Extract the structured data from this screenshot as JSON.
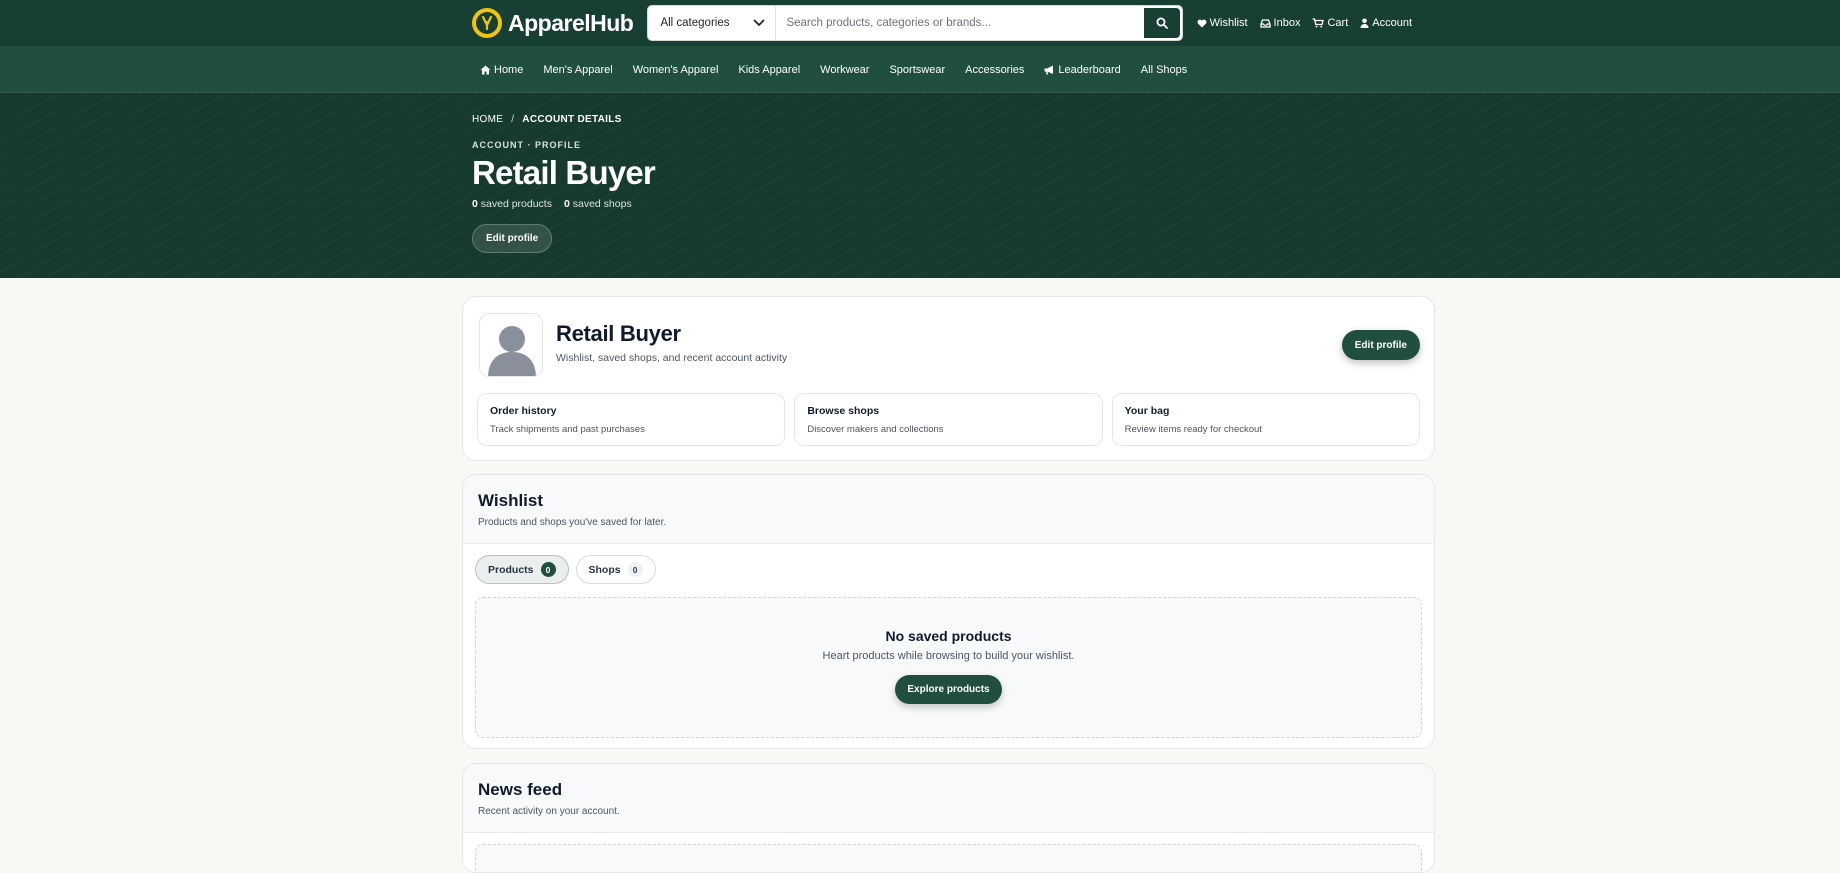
{
  "brand": {
    "name": "ApparelHub",
    "logo_icon": "lightning-bolt-icon",
    "logo_color": "#f2c40f"
  },
  "search": {
    "category": "All categories",
    "placeholder": "Search products, categories or brands..."
  },
  "top_links": [
    {
      "label": "Wishlist",
      "icon": "heart-icon"
    },
    {
      "label": "Inbox",
      "icon": "inbox-icon"
    },
    {
      "label": "Cart",
      "icon": "cart-icon"
    },
    {
      "label": "Account",
      "icon": "user-icon"
    }
  ],
  "nav": [
    {
      "label": "Home",
      "icon": "home-icon"
    },
    {
      "label": "Men's Apparel"
    },
    {
      "label": "Women's Apparel"
    },
    {
      "label": "Kids Apparel"
    },
    {
      "label": "Workwear"
    },
    {
      "label": "Sportswear"
    },
    {
      "label": "Accessories"
    },
    {
      "label": "Leaderboard",
      "icon": "megaphone-icon"
    },
    {
      "label": "All Shops"
    }
  ],
  "hero": {
    "breadcrumb": {
      "home": "HOME",
      "separator": "/",
      "current": "ACCOUNT DETAILS"
    },
    "eyebrow": "ACCOUNT · PROFILE",
    "title": "Retail Buyer",
    "saved_products_count": "0",
    "saved_products_label": "saved products",
    "saved_shops_count": "0",
    "saved_shops_label": "saved shops",
    "edit_label": "Edit profile"
  },
  "profile": {
    "name": "Retail Buyer",
    "subtitle": "Wishlist, saved shops, and recent account activity",
    "edit_label": "Edit profile",
    "tiles": [
      {
        "title": "Order history",
        "subtitle": "Track shipments and past purchases"
      },
      {
        "title": "Browse shops",
        "subtitle": "Discover makers and collections"
      },
      {
        "title": "Your bag",
        "subtitle": "Review items ready for checkout"
      }
    ]
  },
  "wishlist": {
    "title": "Wishlist",
    "subtitle": "Products and shops you've saved for later.",
    "tabs": [
      {
        "label": "Products",
        "count": "0",
        "active": true
      },
      {
        "label": "Shops",
        "count": "0",
        "active": false
      }
    ],
    "empty_title": "No saved products",
    "empty_subtitle": "Heart products while browsing to build your wishlist.",
    "empty_button": "Explore products"
  },
  "news": {
    "title": "News feed",
    "subtitle": "Recent activity on your account."
  },
  "colors": {
    "primary": "#204f40",
    "header": "#183f33",
    "page_bg": "#f9f8f4"
  }
}
